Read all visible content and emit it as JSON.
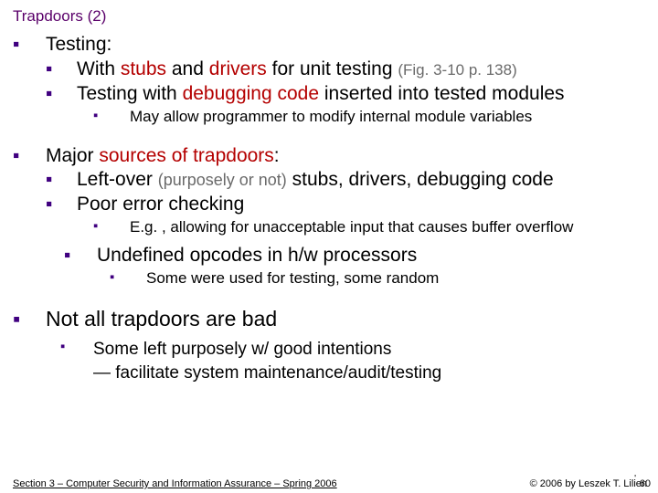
{
  "title": "Trapdoors (2)",
  "l1a": "Testing:",
  "l2a_pre": "With ",
  "l2a_red1": "stubs",
  "l2a_mid1": " and ",
  "l2a_red2": "drivers",
  "l2a_post": " for unit testing  ",
  "l2a_paren": "(Fig. 3-10 p. 138)",
  "l2b_pre": "Testing with ",
  "l2b_red": "debugging code",
  "l2b_post": " inserted into tested modules",
  "l3a": "May allow programmer to modify internal module variables",
  "l1b_pre": "Major ",
  "l1b_red": "sources of trapdoors",
  "l1b_post": ":",
  "l2c_pre": "Left-over ",
  "l2c_paren": "(purposely or not)",
  "l2c_post": " stubs, drivers, debugging code",
  "l2d": "Poor error checking",
  "l3b": "E.g. , allowing for unacceptable input that causes buffer overflow",
  "l2e": "Undefined opcodes in h/w processors",
  "l3c": "Some were used for testing, some random",
  "l1c": "Not all trapdoors are bad",
  "l3d_l1": "Some left purposely w/ good intentions",
  "l3d_l2": "— facilitate system maintenance/audit/testing",
  "footer_left": "Section 3 – Computer Security and Information Assurance – Spring 2006",
  "footer_right": "© 2006 by Leszek T. Lilien",
  "pagenum": "60"
}
